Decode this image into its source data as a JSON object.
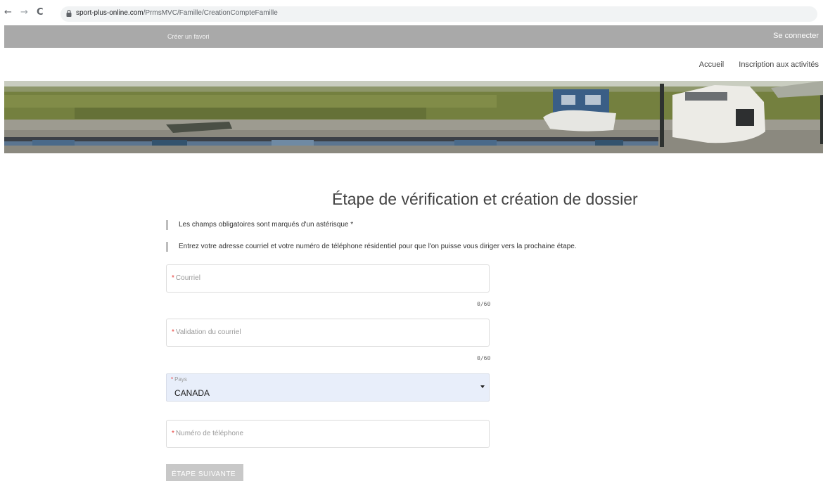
{
  "browser": {
    "url_host": "sport-plus-online.com",
    "url_path": "/PrmsMVC/Famille/CreationCompteFamille",
    "back_icon": "←",
    "forward_icon": "→",
    "reload_icon": "C"
  },
  "topbar": {
    "favorite_label": "Créer un favori",
    "login_label": "Se connecter",
    "background": "#a9a9a9"
  },
  "nav": {
    "items": [
      "Accueil",
      "Inscription aux activités"
    ]
  },
  "page": {
    "title": "Étape de vérification et création de dossier",
    "notes": [
      "Les champs obligatoires sont marqués d'un astérisque *",
      "Entrez votre adresse courriel et votre numéro de téléphone résidentiel pour que l'on puisse vous diriger vers la prochaine étape."
    ]
  },
  "form": {
    "required_mark": "*",
    "email": {
      "label": "Courriel",
      "value": "",
      "counter": "0/60"
    },
    "email_confirm": {
      "label": "Validation du courriel",
      "value": "",
      "counter": "0/60"
    },
    "country": {
      "label": "Pays",
      "selected": "CANADA"
    },
    "phone": {
      "label": "Numéro de téléphone",
      "value": ""
    },
    "next_button": "ÉTAPE SUIVANTE"
  },
  "colors": {
    "required": "#e53935",
    "select_bg": "#e8eefa",
    "button_disabled": "#c8c8c8"
  }
}
